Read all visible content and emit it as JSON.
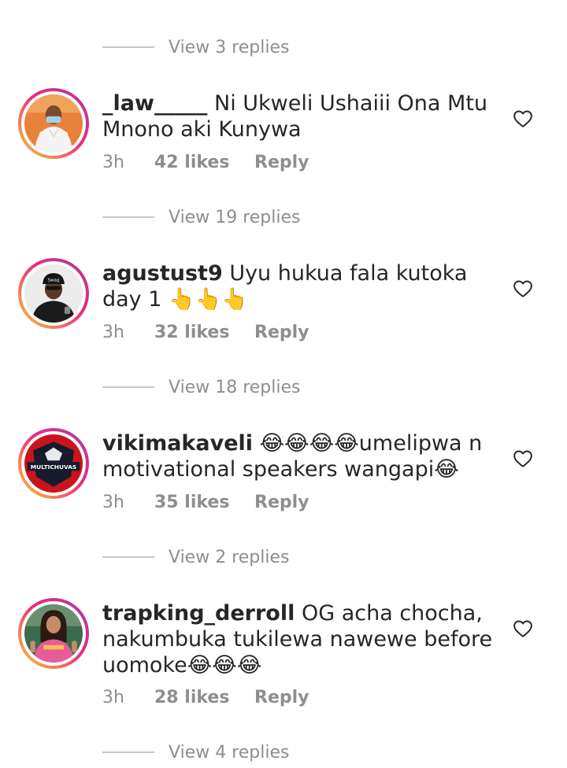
{
  "threads": [
    {
      "view_replies": "View 3 replies"
    },
    {
      "comment": {
        "username": "_law_____",
        "text": " Ni Ukweli Ushaiii Ona Mtu Mnono aki Kunywa",
        "time": "3h",
        "likes": "42 likes",
        "reply": "Reply",
        "avatar_icon": "profile-photo-person-orange-bg"
      },
      "view_replies": "View 19 replies"
    },
    {
      "comment": {
        "username": "agustust9",
        "text": " Uyu hukua fala kutoka day 1 👆👆👆",
        "time": "3h",
        "likes": "32 likes",
        "reply": "Reply",
        "avatar_icon": "profile-photo-person-cap"
      },
      "view_replies": "View 18 replies"
    },
    {
      "comment": {
        "username": "vikimakaveli",
        "text": " 😂😂😂😂umelipwa n motivational speakers wangapi😂",
        "time": "3h",
        "likes": "35 likes",
        "reply": "Reply",
        "avatar_icon": "multichuvas-logo",
        "avatar_text": "MULTICHUVAS"
      },
      "view_replies": "View 2 replies"
    },
    {
      "comment": {
        "username": "trapking_derroll",
        "text": " OG acha chocha, nakumbuka tukilewa nawewe before uomoke😂😂😂",
        "time": "3h",
        "likes": "28 likes",
        "reply": "Reply",
        "avatar_icon": "profile-photo-person-pink"
      },
      "view_replies": "View 4 replies"
    }
  ],
  "colors": {
    "text": "#262626",
    "secondary": "#8e8e8e",
    "divider": "#c7c7c7"
  }
}
